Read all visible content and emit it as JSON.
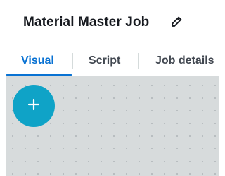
{
  "header": {
    "job_title": "Material Master Job",
    "edit_icon": "pencil-icon"
  },
  "tabs": [
    {
      "label": "Visual",
      "active": true
    },
    {
      "label": "Script",
      "active": false
    },
    {
      "label": "Job details",
      "active": false
    }
  ],
  "canvas": {
    "add_icon": "plus-icon"
  },
  "colors": {
    "accent": "#0972d3",
    "add_button": "#0fa3c7",
    "canvas_background": "#d7dbdc",
    "title_text": "#16191f"
  }
}
